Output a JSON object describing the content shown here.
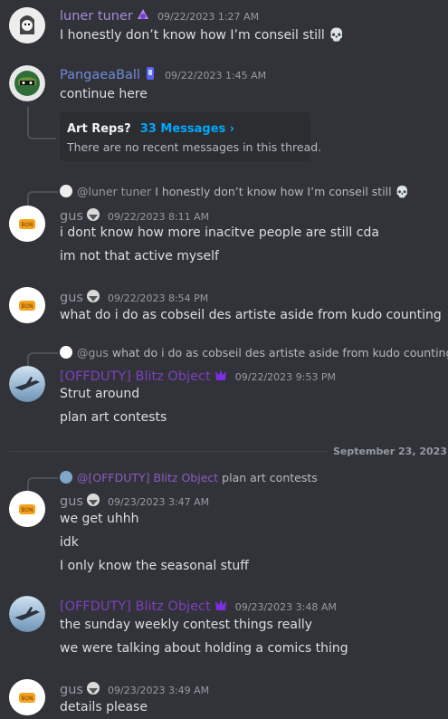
{
  "messages": {
    "m1": {
      "author": "luner tuner",
      "timestamp": "09/22/2023 1:27 AM",
      "lines": [
        "I honestly don’t know how I’m conseil still 💀"
      ]
    },
    "m2": {
      "author": "PangaeaBall",
      "timestamp": "09/22/2023 1:45 AM",
      "lines": [
        "continue here"
      ],
      "thread": {
        "title": "Art Reps?",
        "count": "33 Messages ›",
        "preview": "There are no recent messages in this thread."
      }
    },
    "m3": {
      "reply": {
        "author": "@luner tuner",
        "text": "I honestly don’t know how I’m conseil still 💀"
      },
      "author": "gus",
      "timestamp": "09/22/2023 8:11 AM",
      "lines": [
        "i dont know how more inacitve people are still cda",
        "im not that active myself"
      ]
    },
    "m4": {
      "author": "gus",
      "timestamp": "09/22/2023 8:54 PM",
      "lines": [
        "what do i do as cobseil des artiste aside from kudo counting"
      ]
    },
    "m5": {
      "reply": {
        "author": "@gus",
        "text": "what do i do as cobseil des artiste aside from kudo counting"
      },
      "author": "[OFFDUTY] Blitz Object",
      "timestamp": "09/22/2023 9:53 PM",
      "lines": [
        "Strut around",
        "plan art contests"
      ]
    },
    "divider": "September 23, 2023",
    "m6": {
      "reply": {
        "author": "@[OFFDUTY] Blitz Object",
        "text": "plan art contests"
      },
      "author": "gus",
      "timestamp": "09/23/2023 3:47 AM",
      "lines": [
        "we get uhhh",
        "idk",
        "I only know the seasonal stuff"
      ]
    },
    "m7": {
      "author": "[OFFDUTY] Blitz Object",
      "timestamp": "09/23/2023 3:48 AM",
      "lines": [
        "the sunday weekly contest things really",
        "we were talking about holding a comics thing"
      ]
    },
    "m8": {
      "author": "gus",
      "timestamp": "09/23/2023 3:49 AM",
      "lines": [
        "details please"
      ]
    }
  },
  "colors": {
    "luner": "#a48ad9",
    "pangaea": "#7289da",
    "gus": "#949ba4",
    "blitz": "#7d3fc0",
    "link": "#00a8fc"
  }
}
